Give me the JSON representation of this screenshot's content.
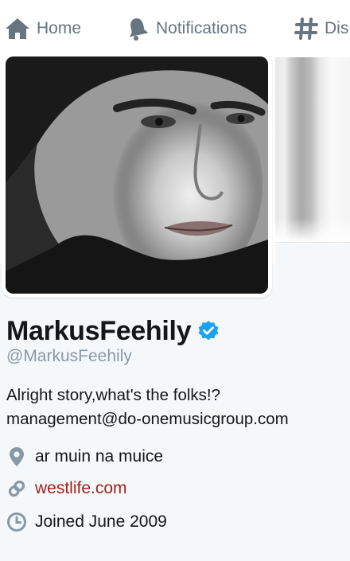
{
  "nav": {
    "home": "Home",
    "notifications": "Notifications",
    "discover": "Dis"
  },
  "profile": {
    "name": "MarkusFeehily",
    "handle": "@MarkusFeehily",
    "bio_line1": "Alright story,what's the folks!?",
    "bio_line2": "management@do-onemusicgroup.com",
    "location": "ar muin na muice",
    "website": "westlife.com",
    "joined": "Joined June 2009"
  },
  "icons": {
    "home": "home-icon",
    "notifications": "bell-icon",
    "discover": "hashtag-icon",
    "verified": "verified-badge-icon",
    "location": "map-pin-icon",
    "website": "link-icon",
    "joined": "clock-icon"
  },
  "colors": {
    "nav_text": "#66757f",
    "link": "#a51f1f",
    "verified": "#1da1f2",
    "handle": "#8899a6",
    "background": "#f5f8fa"
  }
}
